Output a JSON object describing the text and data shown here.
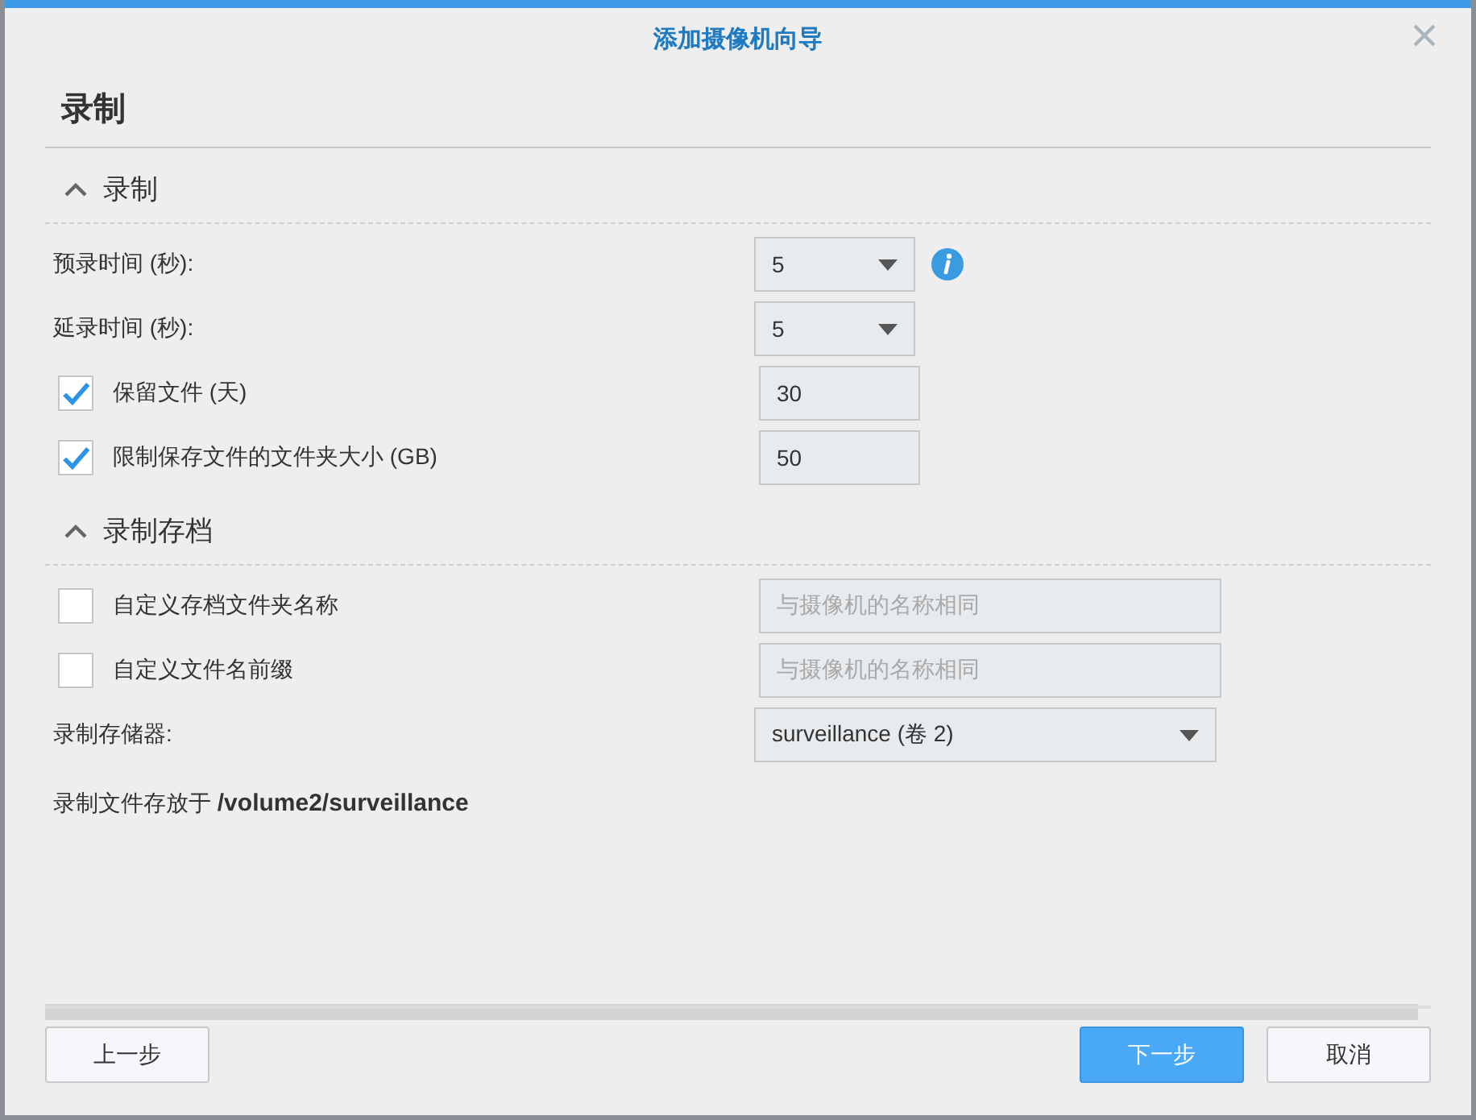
{
  "window": {
    "title": "添加摄像机向导"
  },
  "heading": "录制",
  "sections": [
    {
      "title": "录制",
      "expanded": true,
      "rows": [
        {
          "kind": "select",
          "label": "预录时间 (秒):",
          "value": "5",
          "info": true
        },
        {
          "kind": "select",
          "label": "延录时间 (秒):",
          "value": "5",
          "info": false
        },
        {
          "kind": "check-number",
          "label": "保留文件 (天)",
          "checked": true,
          "value": "30"
        },
        {
          "kind": "check-number",
          "label": "限制保存文件的文件夹大小 (GB)",
          "checked": true,
          "value": "50"
        }
      ]
    },
    {
      "title": "录制存档",
      "expanded": true,
      "rows": [
        {
          "kind": "check-text",
          "label": "自定义存档文件夹名称",
          "checked": false,
          "placeholder": "与摄像机的名称相同"
        },
        {
          "kind": "check-text",
          "label": "自定义文件名前缀",
          "checked": false,
          "placeholder": "与摄像机的名称相同"
        },
        {
          "kind": "wide-select",
          "label": "录制存储器:",
          "value": "surveillance (卷 2)"
        },
        {
          "kind": "note",
          "text": "录制文件存放于 **/volume2/surveillance**"
        }
      ]
    }
  ],
  "buttons": [
    {
      "label": "上一步",
      "kind": "secondary"
    },
    {
      "label": "下一步",
      "kind": "primary"
    },
    {
      "label": "取消",
      "kind": "secondary"
    }
  ]
}
